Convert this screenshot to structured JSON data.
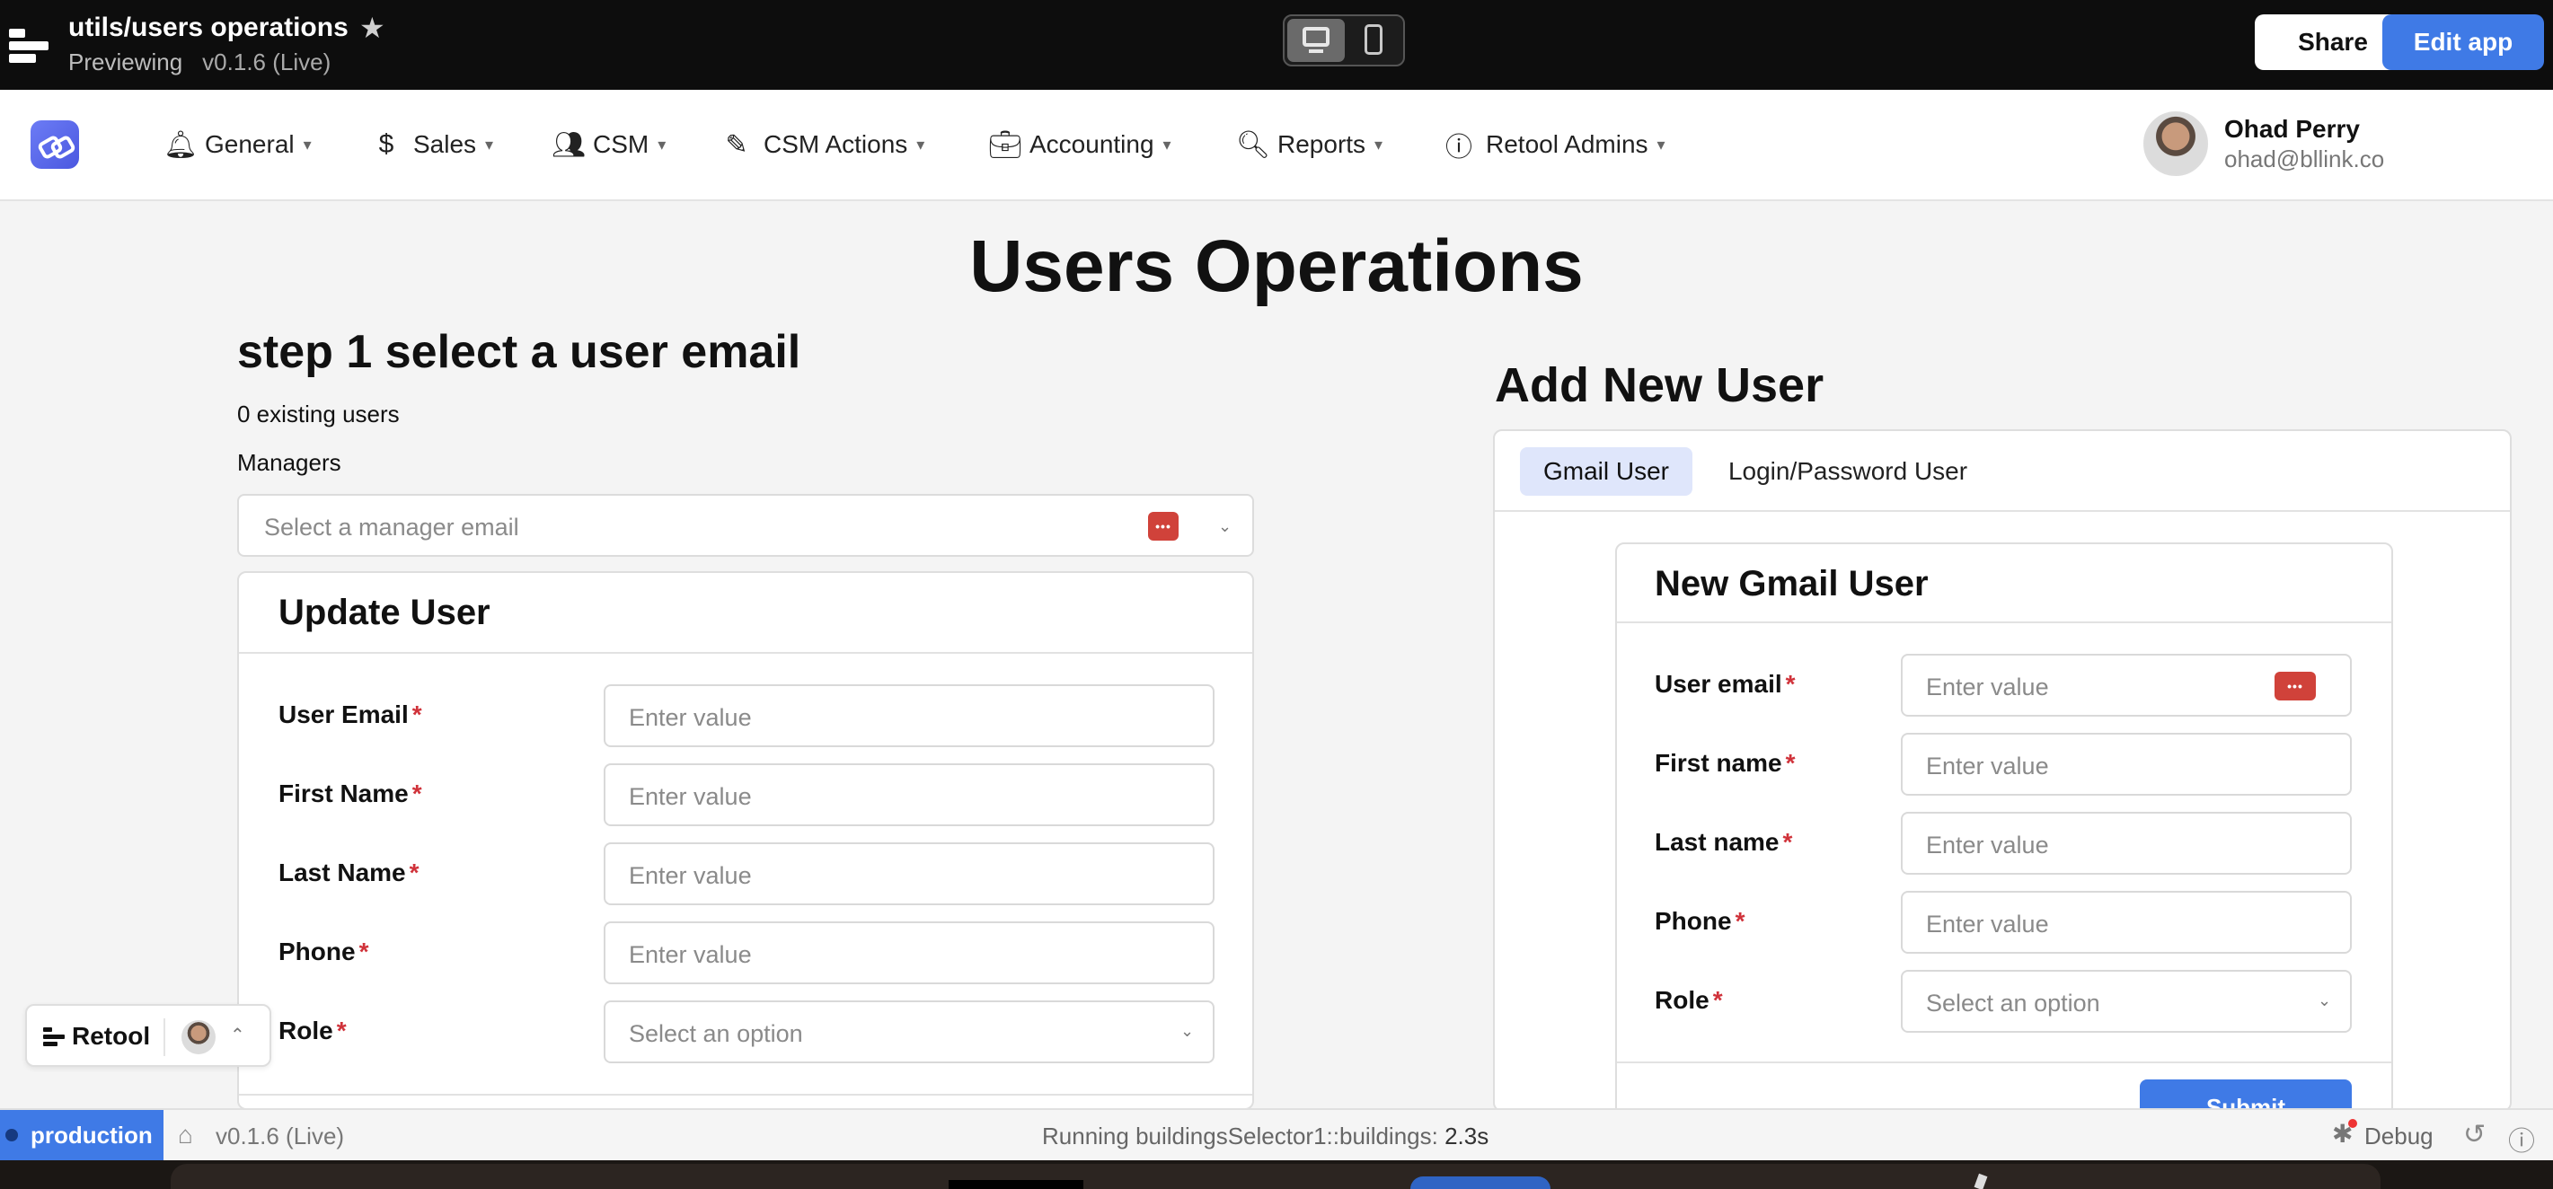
{
  "topbar": {
    "title": "utils/users operations",
    "mode": "Previewing",
    "version": "v0.1.6 (Live)",
    "share_label": "Share",
    "edit_label": "Edit app"
  },
  "nav": {
    "items": [
      {
        "label": "General",
        "icon": "bell-icon"
      },
      {
        "label": "Sales",
        "icon": "dollar-icon"
      },
      {
        "label": "CSM",
        "icon": "people-icon"
      },
      {
        "label": "CSM Actions",
        "icon": "pencil-icon"
      },
      {
        "label": "Accounting",
        "icon": "briefcase-icon"
      },
      {
        "label": "Reports",
        "icon": "report-search-icon"
      },
      {
        "label": "Retool Admins",
        "icon": "info-icon"
      }
    ],
    "user": {
      "name": "Ohad Perry",
      "email": "ohad@bllink.co"
    }
  },
  "page": {
    "title": "Users Operations"
  },
  "step1": {
    "title": "step 1 select a user email",
    "existing": "0 existing users",
    "managers_label": "Managers",
    "manager_placeholder": "Select a manager email"
  },
  "update_user": {
    "title": "Update User",
    "fields": [
      {
        "label": "User Email",
        "placeholder": "Enter value"
      },
      {
        "label": "First Name",
        "placeholder": "Enter value"
      },
      {
        "label": "Last Name",
        "placeholder": "Enter value"
      },
      {
        "label": "Phone",
        "placeholder": "Enter value"
      },
      {
        "label": "Role",
        "placeholder": "Select an option"
      }
    ]
  },
  "add_user": {
    "title": "Add New User",
    "tabs": [
      "Gmail User",
      "Login/Password User"
    ],
    "active_tab": "Gmail User",
    "form_title": "New Gmail User",
    "fields": [
      {
        "label": "User email",
        "placeholder": "Enter value"
      },
      {
        "label": "First name",
        "placeholder": "Enter value"
      },
      {
        "label": "Last name",
        "placeholder": "Enter value"
      },
      {
        "label": "Phone",
        "placeholder": "Enter value"
      },
      {
        "label": "Role",
        "placeholder": "Select an option"
      }
    ],
    "submit_label": "Submit"
  },
  "retool_badge": {
    "label": "Retool"
  },
  "status": {
    "env": "production",
    "version": "v0.1.6 (Live)",
    "running_prefix": "Running buildingsSelector1::buildings:",
    "running_time": "2.3s",
    "debug": "Debug"
  },
  "colors": {
    "accent": "#3f7ae6",
    "required": "#d0323a",
    "password_badge": "#d0423a",
    "tab_active": "#dfe6fb"
  }
}
